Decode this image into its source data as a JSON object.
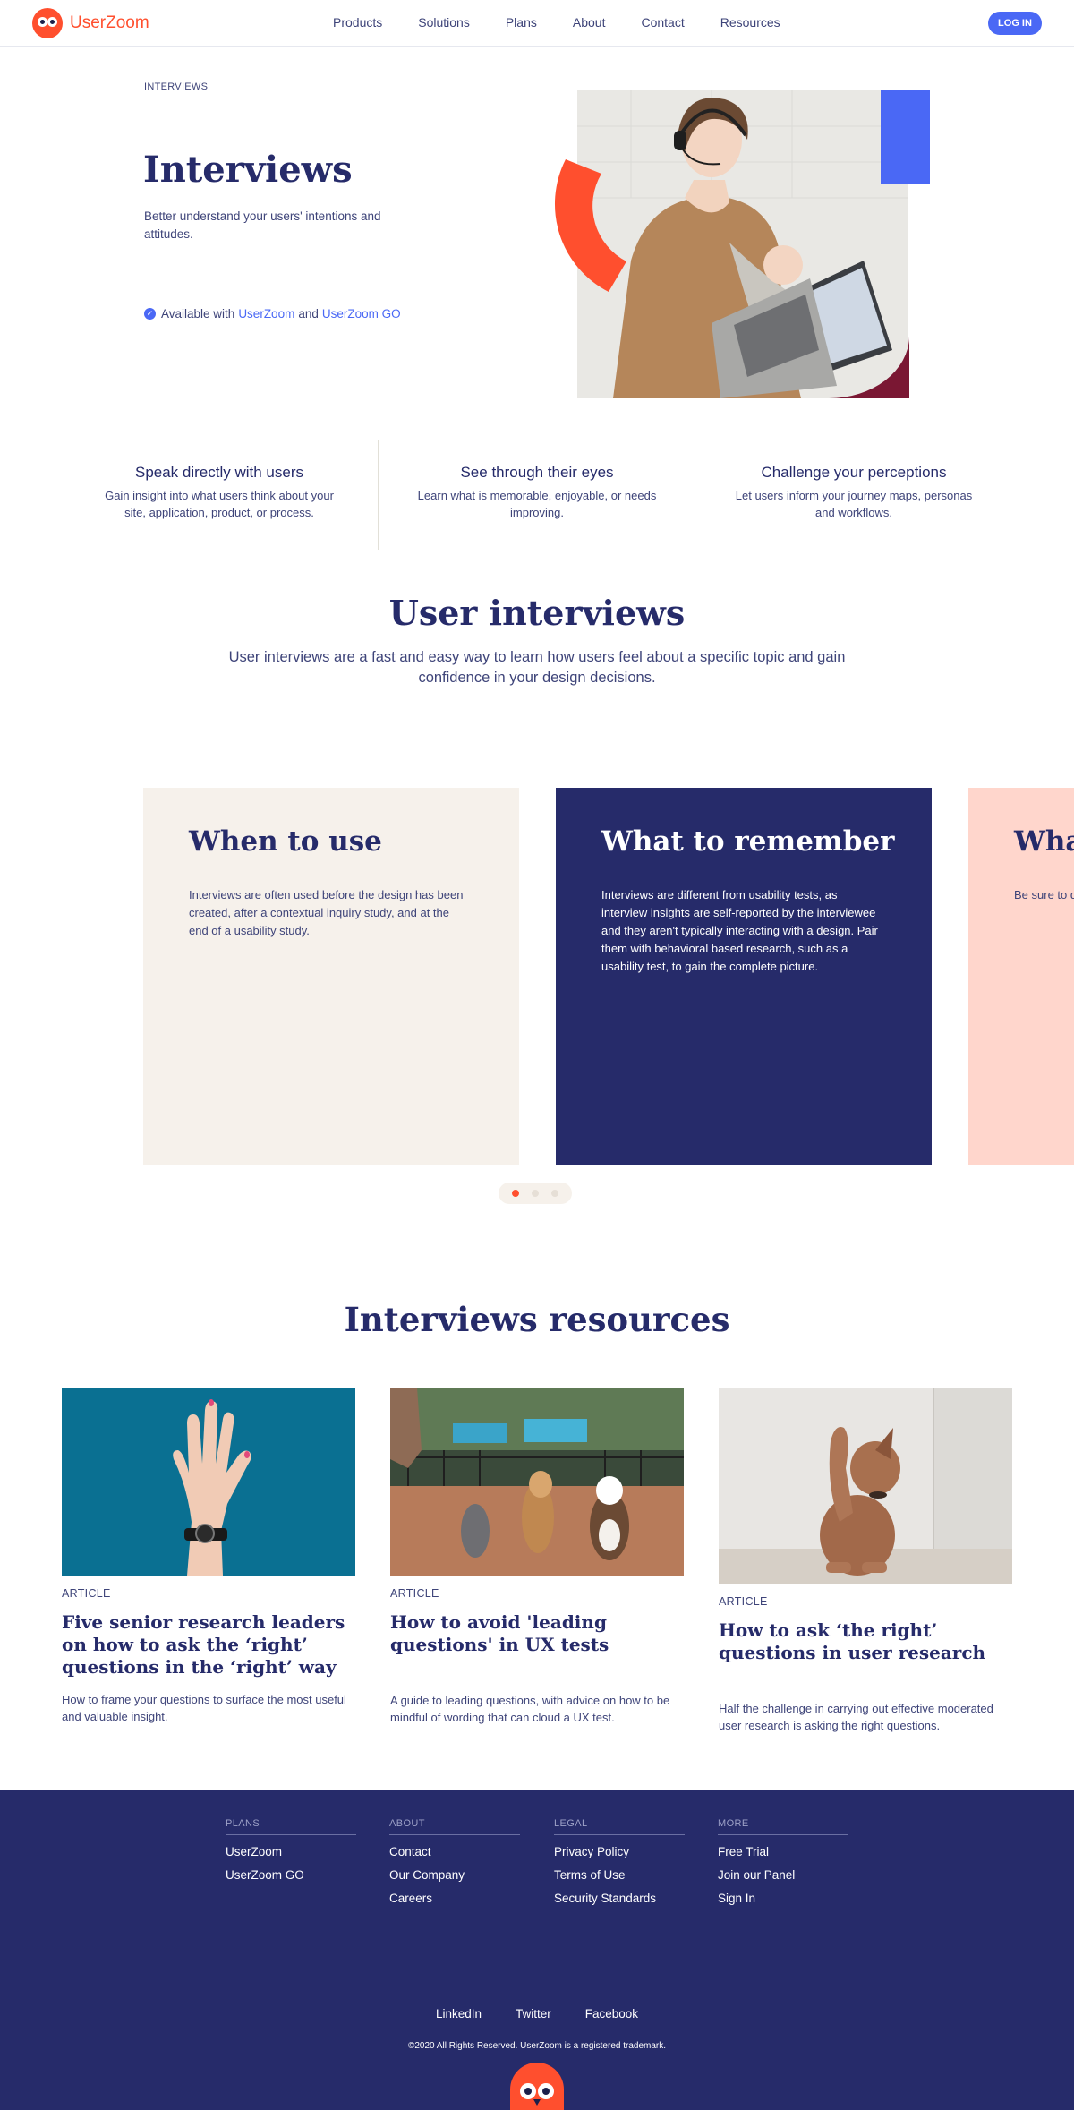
{
  "header": {
    "brand": "UserZoom",
    "nav": [
      "Products",
      "Solutions",
      "Plans",
      "About",
      "Contact",
      "Resources"
    ],
    "login_label": "LOG IN"
  },
  "hero": {
    "eyebrow": "INTERVIEWS",
    "title": "Interviews",
    "subtitle": "Better understand your users' intentions and attitudes.",
    "available_prefix": "Available with",
    "available_link1": "UserZoom",
    "available_and": "and",
    "available_link2": "UserZoom GO",
    "accent_colors": {
      "orange": "#FF4F2E",
      "blue": "#4A68F5",
      "maroon": "#7A1733"
    }
  },
  "features": [
    {
      "title": "Speak directly with users",
      "text": "Gain insight into what users think about your site, application, product, or process."
    },
    {
      "title": "See through their eyes",
      "text": "Learn what is memorable, enjoyable, or needs improving."
    },
    {
      "title": "Challenge your perceptions",
      "text": "Let users inform your journey maps, personas and workflows."
    }
  ],
  "user_interviews": {
    "title": "User interviews",
    "subtitle": "User interviews are a fast and easy way to learn how users feel about a specific topic and gain confidence in your design decisions."
  },
  "cards": [
    {
      "title": "When to use",
      "text": "Interviews are often used before the design has been created, after a contextual inquiry study, and at the end of a usability study."
    },
    {
      "title": "What to remember",
      "text": "Interviews are different from usability tests, as interview insights are self-reported by the interviewee and they aren't typically interacting with a design. Pair them with behavioral based research, such as a usability test, to gain the complete picture."
    },
    {
      "title": "Wha",
      "text": "Be sure to questions y to anticipa up questio"
    }
  ],
  "carousel": {
    "active_index": 0,
    "count": 3
  },
  "resources": {
    "title": "Interviews resources",
    "items": [
      {
        "tag": "ARTICLE",
        "title": "Five senior research leaders on how to ask the ‘right’ questions in the ‘right’ way",
        "text": "How to frame your questions to surface the most useful and valuable insight."
      },
      {
        "tag": "ARTICLE",
        "title": "How to avoid 'leading questions' in UX tests",
        "text": "A guide to leading questions, with advice on how to be mindful of wording that can cloud a UX test."
      },
      {
        "tag": "ARTICLE",
        "title": "How to ask ‘the right’ questions in user research",
        "text": "Half the challenge in carrying out effective moderated user research is asking the right questions."
      }
    ]
  },
  "footer": {
    "columns": [
      {
        "head": "PLANS",
        "items": [
          "UserZoom",
          "UserZoom GO"
        ]
      },
      {
        "head": "ABOUT",
        "items": [
          "Contact",
          "Our Company",
          "Careers"
        ]
      },
      {
        "head": "LEGAL",
        "items": [
          "Privacy Policy",
          "Terms of Use",
          "Security Standards"
        ]
      },
      {
        "head": "MORE",
        "items": [
          "Free Trial",
          "Join our Panel",
          "Sign In"
        ]
      }
    ],
    "social": [
      "LinkedIn",
      "Twitter",
      "Facebook"
    ],
    "copyright": "©2020 All Rights Reserved. UserZoom is a registered trademark."
  }
}
